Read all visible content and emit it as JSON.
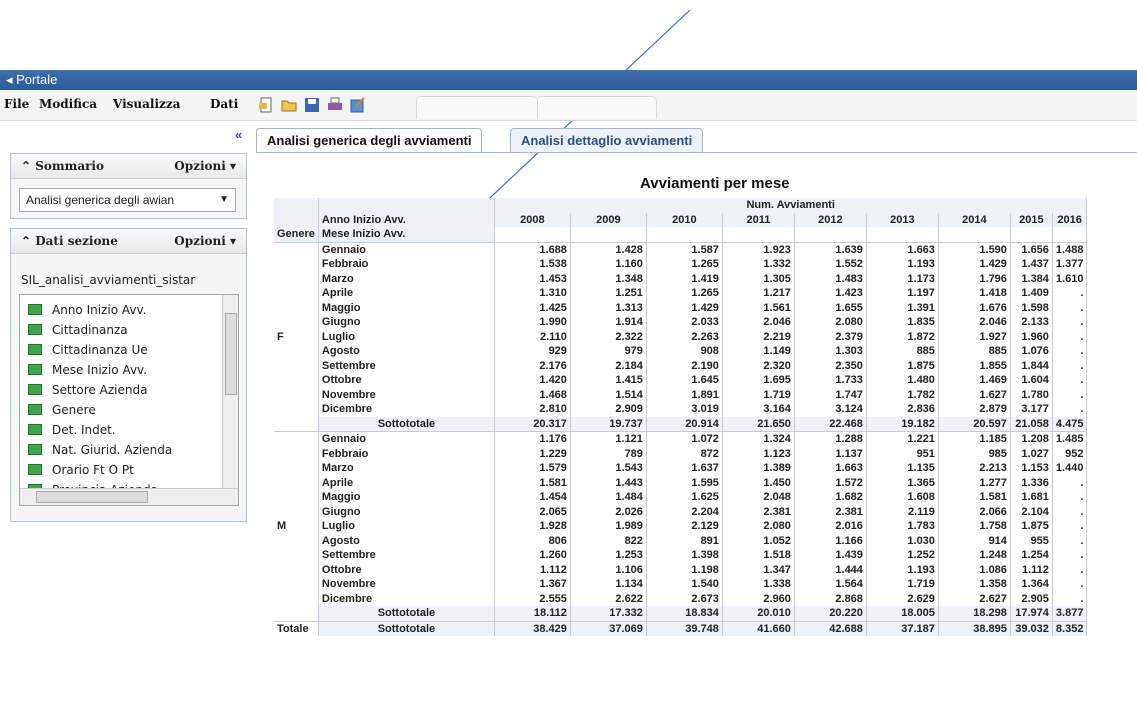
{
  "window": {
    "title": "Portale"
  },
  "menu": [
    "File",
    "Modifica",
    "Visualizza",
    "Dati"
  ],
  "toolbar_icons": [
    "new-icon",
    "open-icon",
    "save-icon",
    "print-icon",
    "export-icon"
  ],
  "collapse_glyph": "«",
  "sommario": {
    "title": "Sommario",
    "options": "Opzioni",
    "selected": "Analisi generica degli awian"
  },
  "dati_sezione": {
    "title": "Dati sezione",
    "options": "Opzioni",
    "datasource": "SIL_analisi_avviamenti_sistar",
    "fields": [
      "Anno Inizio Avv.",
      "Cittadinanza",
      "Cittadinanza Ue",
      "Mese Inizio Avv.",
      "Settore Azienda",
      "Genere",
      "Det. Indet.",
      "Nat. Giurid. Azienda",
      "Orario Ft O Pt",
      "Provincia Azienda"
    ]
  },
  "tabs": [
    "Analisi generica degli avviamenti",
    "Analisi dettaglio avviamenti"
  ],
  "report": {
    "title": "Avviamenti per mese",
    "measure_header": "Num. Avviamenti",
    "col_dim_label": "Anno Inizio Avv.",
    "row_dim_labels": [
      "Genere",
      "Mese Inizio Avv."
    ],
    "years": [
      "2008",
      "2009",
      "2010",
      "2011",
      "2012",
      "2013",
      "2014",
      "2015",
      "2016"
    ],
    "groups": [
      {
        "genere": "F",
        "rows": [
          {
            "mese": "Gennaio",
            "values": [
              "1.688",
              "1.428",
              "1.587",
              "1.923",
              "1.639",
              "1.663",
              "1.590",
              "1.656",
              "1.488"
            ]
          },
          {
            "mese": "Febbraio",
            "values": [
              "1.538",
              "1.160",
              "1.265",
              "1.332",
              "1.552",
              "1.193",
              "1.429",
              "1.437",
              "1.377"
            ]
          },
          {
            "mese": "Marzo",
            "values": [
              "1.453",
              "1.348",
              "1.419",
              "1.305",
              "1.483",
              "1.173",
              "1.796",
              "1.384",
              "1.610"
            ]
          },
          {
            "mese": "Aprile",
            "values": [
              "1.310",
              "1.251",
              "1.265",
              "1.217",
              "1.423",
              "1.197",
              "1.418",
              "1.409",
              "."
            ]
          },
          {
            "mese": "Maggio",
            "values": [
              "1.425",
              "1.313",
              "1.429",
              "1.561",
              "1.655",
              "1.391",
              "1.676",
              "1.598",
              "."
            ]
          },
          {
            "mese": "Giugno",
            "values": [
              "1.990",
              "1.914",
              "2.033",
              "2.046",
              "2.080",
              "1.835",
              "2.046",
              "2.133",
              "."
            ]
          },
          {
            "mese": "Luglio",
            "values": [
              "2.110",
              "2.322",
              "2.263",
              "2.219",
              "2.379",
              "1.872",
              "1.927",
              "1.960",
              "."
            ]
          },
          {
            "mese": "Agosto",
            "values": [
              "929",
              "979",
              "908",
              "1.149",
              "1.303",
              "885",
              "885",
              "1.076",
              "."
            ]
          },
          {
            "mese": "Settembre",
            "values": [
              "2.176",
              "2.184",
              "2.190",
              "2.320",
              "2.350",
              "1.875",
              "1.855",
              "1.844",
              "."
            ]
          },
          {
            "mese": "Ottobre",
            "values": [
              "1.420",
              "1.415",
              "1.645",
              "1.695",
              "1.733",
              "1.480",
              "1.469",
              "1.604",
              "."
            ]
          },
          {
            "mese": "Novembre",
            "values": [
              "1.468",
              "1.514",
              "1.891",
              "1.719",
              "1.747",
              "1.782",
              "1.627",
              "1.780",
              "."
            ]
          },
          {
            "mese": "Dicembre",
            "values": [
              "2.810",
              "2.909",
              "3.019",
              "3.164",
              "3.124",
              "2.836",
              "2.879",
              "3.177",
              "."
            ]
          },
          {
            "mese": "Sottototale",
            "subtotal": true,
            "values": [
              "20.317",
              "19.737",
              "20.914",
              "21.650",
              "22.468",
              "19.182",
              "20.597",
              "21.058",
              "4.475"
            ]
          }
        ]
      },
      {
        "genere": "M",
        "rows": [
          {
            "mese": "Gennaio",
            "values": [
              "1.176",
              "1.121",
              "1.072",
              "1.324",
              "1.288",
              "1.221",
              "1.185",
              "1.208",
              "1.485"
            ]
          },
          {
            "mese": "Febbraio",
            "values": [
              "1.229",
              "789",
              "872",
              "1.123",
              "1.137",
              "951",
              "985",
              "1.027",
              "952"
            ]
          },
          {
            "mese": "Marzo",
            "values": [
              "1.579",
              "1.543",
              "1.637",
              "1.389",
              "1.663",
              "1.135",
              "2.213",
              "1.153",
              "1.440"
            ]
          },
          {
            "mese": "Aprile",
            "values": [
              "1.581",
              "1.443",
              "1.595",
              "1.450",
              "1.572",
              "1.365",
              "1.277",
              "1.336",
              "."
            ]
          },
          {
            "mese": "Maggio",
            "values": [
              "1.454",
              "1.484",
              "1.625",
              "2.048",
              "1.682",
              "1.608",
              "1.581",
              "1.681",
              "."
            ]
          },
          {
            "mese": "Giugno",
            "values": [
              "2.065",
              "2.026",
              "2.204",
              "2.381",
              "2.381",
              "2.119",
              "2.066",
              "2.104",
              "."
            ]
          },
          {
            "mese": "Luglio",
            "values": [
              "1.928",
              "1.989",
              "2.129",
              "2.080",
              "2.016",
              "1.783",
              "1.758",
              "1.875",
              "."
            ]
          },
          {
            "mese": "Agosto",
            "values": [
              "806",
              "822",
              "891",
              "1.052",
              "1.166",
              "1.030",
              "914",
              "955",
              "."
            ]
          },
          {
            "mese": "Settembre",
            "values": [
              "1.260",
              "1.253",
              "1.398",
              "1.518",
              "1.439",
              "1.252",
              "1.248",
              "1.254",
              "."
            ]
          },
          {
            "mese": "Ottobre",
            "values": [
              "1.112",
              "1.106",
              "1.198",
              "1.347",
              "1.444",
              "1.193",
              "1.086",
              "1.112",
              "."
            ]
          },
          {
            "mese": "Novembre",
            "values": [
              "1.367",
              "1.134",
              "1.540",
              "1.338",
              "1.564",
              "1.719",
              "1.358",
              "1.364",
              "."
            ]
          },
          {
            "mese": "Dicembre",
            "values": [
              "2.555",
              "2.622",
              "2.673",
              "2.960",
              "2.868",
              "2.629",
              "2.627",
              "2.905",
              "."
            ]
          },
          {
            "mese": "Sottototale",
            "subtotal": true,
            "values": [
              "18.112",
              "17.332",
              "18.834",
              "20.010",
              "20.220",
              "18.005",
              "18.298",
              "17.974",
              "3.877"
            ]
          }
        ]
      }
    ],
    "total": {
      "label": "Totale",
      "mese": "Sottototale",
      "values": [
        "38.429",
        "37.069",
        "39.748",
        "41.660",
        "42.688",
        "37.187",
        "38.895",
        "39.032",
        "8.352"
      ]
    }
  },
  "colors": {
    "titlebar": "#2c5a99",
    "accent": "#3a6bb0",
    "tab_inactive_text": "#2b4f86"
  }
}
